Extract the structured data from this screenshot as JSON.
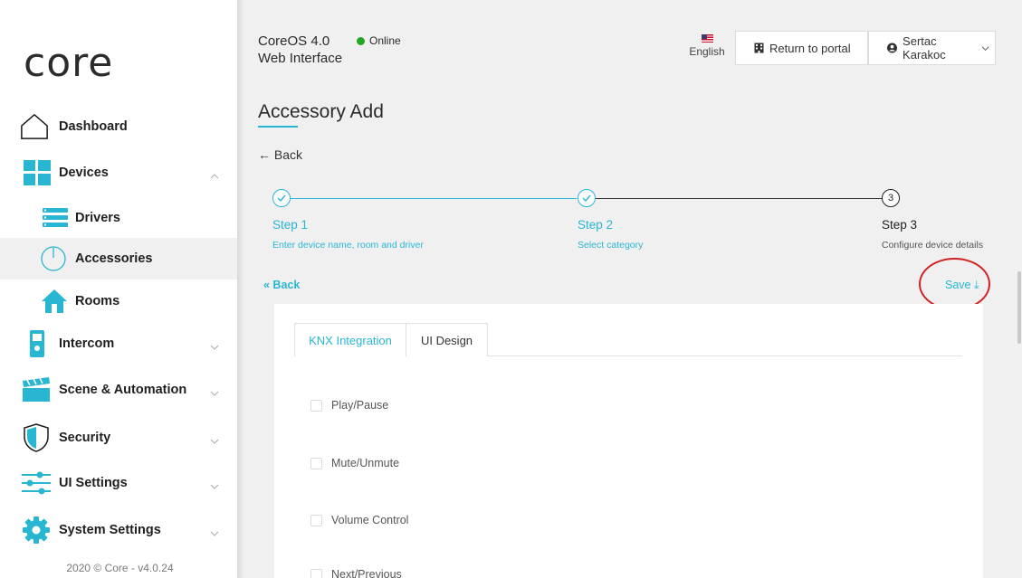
{
  "sidebar": {
    "logo": "core",
    "items": [
      {
        "label": "Dashboard",
        "icon": "home-icon"
      },
      {
        "label": "Devices",
        "icon": "grid-icon"
      },
      {
        "label": "Drivers",
        "icon": "list-icon"
      },
      {
        "label": "Accessories",
        "icon": "power-icon"
      },
      {
        "label": "Rooms",
        "icon": "house-icon"
      },
      {
        "label": "Intercom",
        "icon": "intercom-icon"
      },
      {
        "label": "Scene & Automation",
        "icon": "clapperboard-icon"
      },
      {
        "label": "Security",
        "icon": "shield-icon"
      },
      {
        "label": "UI Settings",
        "icon": "sliders-icon"
      },
      {
        "label": "System Settings",
        "icon": "gear-icon"
      }
    ],
    "footer": "2020 © Core - v4.0.24"
  },
  "header": {
    "title_line1": "CoreOS 4.0",
    "title_line2": "Web Interface",
    "status": "Online",
    "language": "English",
    "portal_button": "Return to portal",
    "user_button": "Sertac Karakoc"
  },
  "page": {
    "title": "Accessory Add",
    "back": "← Back",
    "steps": [
      {
        "number": "1",
        "title": "Step 1",
        "desc": "Enter device name, room and driver",
        "state": "done"
      },
      {
        "number": "2",
        "title": "Step 2",
        "desc": "Select category",
        "state": "done"
      },
      {
        "number": "3",
        "title": "Step 3",
        "desc": "Configure device details",
        "state": "current"
      }
    ],
    "inner_back": "« Back",
    "save": "Save ⤓",
    "tabs": [
      "KNX Integration",
      "UI Design"
    ],
    "checkboxes": [
      "Play/Pause",
      "Mute/Unmute",
      "Volume Control",
      "Next/Previous"
    ]
  },
  "colors": {
    "accent": "#29b6d3",
    "online": "#22a722",
    "annotation": "#d32020"
  }
}
